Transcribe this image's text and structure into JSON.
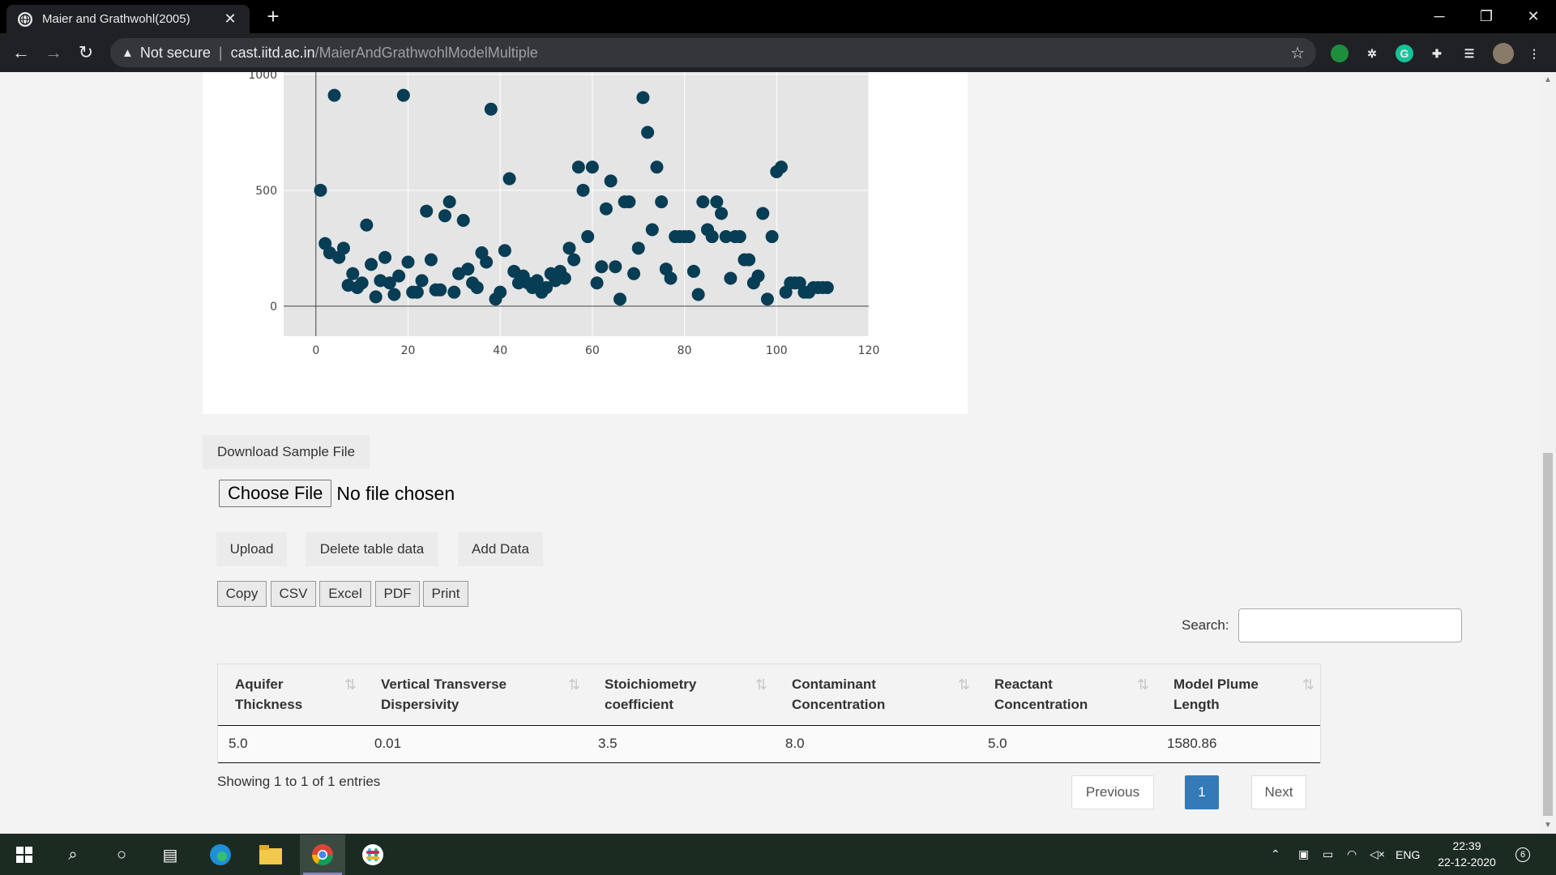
{
  "browser": {
    "tab_title": "Maier and Grathwohl(2005)",
    "new_tab": "+",
    "security_label": "Not secure",
    "url_host": "cast.iitd.ac.in",
    "url_path": "/MaierAndGrathwohlModelMultiple"
  },
  "chart_data": {
    "type": "scatter",
    "title": "",
    "xlabel": "",
    "ylabel": "",
    "xlim": [
      -7,
      120
    ],
    "ylim": [
      -130,
      1010
    ],
    "x_ticks": [
      0,
      20,
      40,
      60,
      80,
      100,
      120
    ],
    "y_ticks": [
      0,
      500,
      1000
    ],
    "grid": true,
    "marker_color": "#073d55",
    "series": [
      {
        "x": [
          1,
          2,
          3,
          4,
          5,
          6,
          7,
          8,
          9,
          10,
          11,
          12,
          13,
          14,
          15,
          16,
          17,
          18,
          19,
          20,
          21,
          22,
          23,
          24,
          25,
          26,
          27,
          28,
          29,
          30,
          31,
          32,
          33,
          34,
          35,
          36,
          37,
          38,
          39,
          40,
          41,
          42,
          43,
          44,
          45,
          46,
          47,
          48,
          49,
          50,
          51,
          52,
          53,
          54,
          55,
          56,
          57,
          58,
          59,
          60,
          61,
          62,
          63,
          64,
          65,
          66,
          67,
          68,
          69,
          70,
          71,
          72,
          73,
          74,
          75,
          76,
          77,
          78,
          79,
          80,
          81,
          82,
          83,
          84,
          85,
          86,
          87,
          88,
          89,
          90,
          91,
          92,
          93,
          94,
          95,
          96,
          97,
          98,
          99,
          100,
          101,
          102,
          103,
          104,
          105,
          106,
          107,
          108,
          109,
          110,
          111
        ],
        "y": [
          500,
          270,
          230,
          910,
          210,
          250,
          90,
          140,
          80,
          100,
          350,
          180,
          40,
          110,
          210,
          100,
          50,
          130,
          910,
          190,
          60,
          60,
          110,
          410,
          200,
          70,
          70,
          390,
          450,
          60,
          140,
          370,
          160,
          100,
          80,
          230,
          190,
          850,
          30,
          60,
          240,
          550,
          150,
          100,
          130,
          100,
          80,
          110,
          60,
          80,
          140,
          110,
          150,
          120,
          250,
          200,
          600,
          500,
          300,
          600,
          100,
          170,
          420,
          540,
          170,
          30,
          450,
          450,
          140,
          250,
          900,
          750,
          330,
          600,
          450,
          160,
          120,
          300,
          300,
          300,
          300,
          150,
          50,
          450,
          330,
          300,
          450,
          400,
          300,
          120,
          300,
          300,
          200,
          200,
          100,
          130,
          400,
          30,
          300,
          580,
          600,
          60,
          100,
          100,
          100,
          60,
          60,
          80,
          80,
          80,
          80
        ]
      }
    ]
  },
  "buttons": {
    "download": "Download Sample File",
    "choose_file": "Choose File",
    "no_file": "No file chosen",
    "upload": "Upload",
    "delete": "Delete table data",
    "add": "Add Data"
  },
  "export_buttons": {
    "copy": "Copy",
    "csv": "CSV",
    "excel": "Excel",
    "pdf": "PDF",
    "print": "Print"
  },
  "search": {
    "label": "Search:",
    "value": ""
  },
  "table": {
    "headers": [
      {
        "l1": "Aquifer",
        "l2": "Thickness"
      },
      {
        "l1": "Vertical Transverse",
        "l2": "Dispersivity"
      },
      {
        "l1": "Stoichiometry",
        "l2": "coefficient"
      },
      {
        "l1": "Contaminant",
        "l2": "Concentration"
      },
      {
        "l1": "Reactant",
        "l2": "Concentration"
      },
      {
        "l1": "Model Plume",
        "l2": "Length"
      }
    ],
    "rows": [
      [
        "5.0",
        "0.01",
        "3.5",
        "8.0",
        "5.0",
        "1580.86"
      ]
    ]
  },
  "table_info": "Showing 1 to 1 of 1 entries",
  "pagination": {
    "previous": "Previous",
    "page": "1",
    "next": "Next"
  },
  "taskbar": {
    "tray_lang": "ENG",
    "time": "22:39",
    "date": "22-12-2020",
    "notif_count": "6"
  }
}
